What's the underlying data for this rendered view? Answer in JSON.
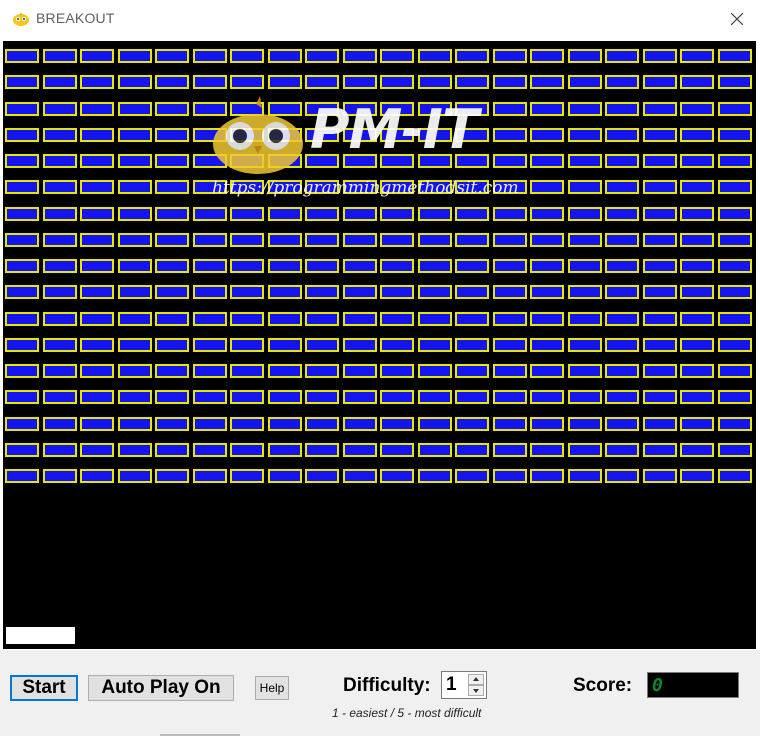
{
  "window": {
    "title": "BREAKOUT",
    "close_label": "✕",
    "app_icon": "bird-icon"
  },
  "game": {
    "brick_rows": 17,
    "brick_columns": 20,
    "colors": {
      "background": "#000000",
      "brick_fill": "#1414f0",
      "brick_border": "#e6e600",
      "paddle": "#ffffff"
    }
  },
  "watermark": {
    "logo_text": "PM-IT",
    "url": "https://programmingmethodsit.com",
    "icon": "owl-logo-icon"
  },
  "controls": {
    "start_label": "Start",
    "autoplay_label": "Auto Play On",
    "help_label": "Help",
    "difficulty_label": "Difficulty:",
    "difficulty_value": "1",
    "difficulty_hint": "1 - easiest / 5 - most difficult",
    "score_label": "Score:",
    "score_value": "0",
    "colors": {
      "accent": "#0078d7",
      "score_text": "#0e8a2e"
    }
  }
}
